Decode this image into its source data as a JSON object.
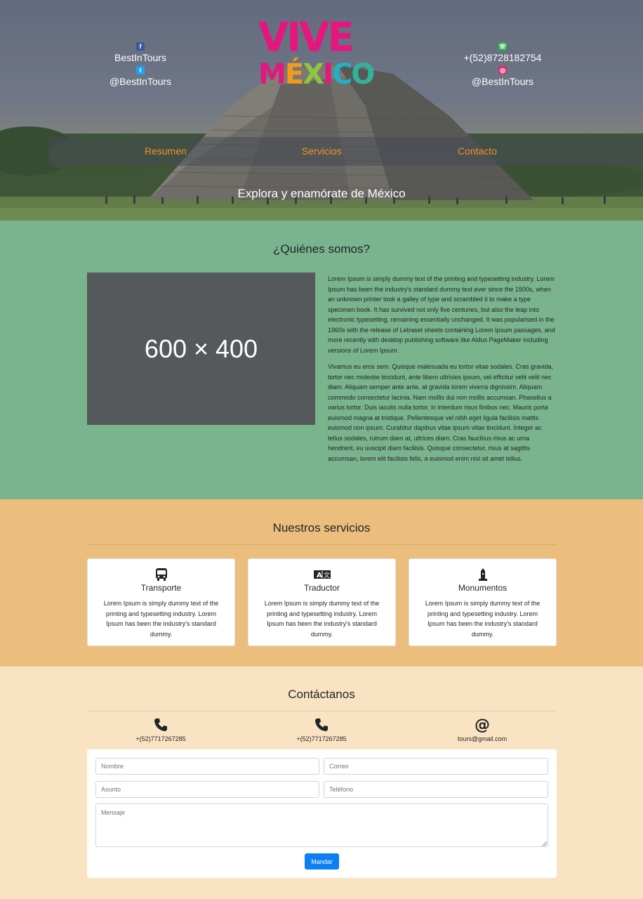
{
  "header": {
    "left_social": [
      {
        "icon": "facebook-icon",
        "label": "BestInTours"
      },
      {
        "icon": "twitter-icon",
        "label": "@BestInTours"
      }
    ],
    "right_social": [
      {
        "icon": "whatsapp-icon",
        "label": "+(52)8728182754"
      },
      {
        "icon": "instagram-icon",
        "label": "@BestInTours"
      }
    ],
    "logo": {
      "line1": "VIVE",
      "line2_letters": [
        "M",
        "É",
        "X",
        "I",
        "C",
        "O"
      ]
    },
    "nav": [
      "Resumen",
      "Servicios",
      "Contacto"
    ],
    "tagline": "Explora y enamórate de México"
  },
  "about": {
    "title": "¿Quiénes somos?",
    "image_placeholder": "600 × 400",
    "paragraphs": [
      "Lorem Ipsum is simply dummy text of the printing and typesetting industry. Lorem Ipsum has been the industry's standard dummy text ever since the 1500s, when an unknown printer took a galley of type and scrambled it to make a type specimen book. It has survived not only five centuries, but also the leap into electronic typesetting, remaining essentially unchanged. It was popularised in the 1960s with the release of Letraset sheets containing Lorem Ipsum passages, and more recently with desktop publishing software like Aldus PageMaker including versions of Lorem Ipsum.",
      "Vivamus eu eros sem. Quisque malesuada eu tortor vitae sodales. Cras gravida, tortor nec molestie tincidunt, ante libero ultricies ipsum, vel efficitur velit velit nec diam. Aliquam semper ante ante, at gravida lorem viverra dignissim. Aliquam commodo consectetur lacinia. Nam mollis dui non mollis accumsan. Phasellus a varius tortor. Duis iaculis nulla tortor, in interdum risus finibus nec. Mauris porta euismod magna at tristique. Pellentesque vel nibh eget ligula facilisis mattis euismod non ipsum. Curabitur dapibus vitae ipsum vitae tincidunt. Integer ac tellus sodales, rutrum diam at, ultrices diam. Cras faucibus risus ac urna hendrerit, eu suscipit diam facilisis. Quisque consectetur, risus at sagittis accumsan, lorem elit facilisis felis, a euismod enim nisl sit amet tellus."
    ]
  },
  "services": {
    "title": "Nuestros servicios",
    "cards": [
      {
        "icon": "bus-icon",
        "title": "Transporte",
        "desc": "Lorem Ipsum is simply dummy text of the printing and typesetting industry. Lorem Ipsum has been the industry's standard dummy."
      },
      {
        "icon": "translate-icon",
        "title": "Traductor",
        "desc": "Lorem Ipsum is simply dummy text of the printing and typesetting industry. Lorem Ipsum has been the industry's standard dummy."
      },
      {
        "icon": "monument-icon",
        "title": "Monumentos",
        "desc": "Lorem Ipsum is simply dummy text of the printing and typesetting industry. Lorem Ipsum has been the industry's standard dummy."
      }
    ]
  },
  "contact": {
    "title": "Contáctanos",
    "items": [
      {
        "icon": "phone-icon",
        "text": "+(52)7717267285"
      },
      {
        "icon": "phone-icon",
        "text": "+(52)7717267285"
      },
      {
        "icon": "at-icon",
        "text": "tours@gmail.com"
      }
    ],
    "form": {
      "name_placeholder": "Nombre",
      "email_placeholder": "Correo",
      "subject_placeholder": "Asunto",
      "phone_placeholder": "Teléfono",
      "message_placeholder": "Mensaje",
      "submit_label": "Mandar"
    }
  },
  "colors": {
    "hero_nav_link": "#f0941e",
    "about_bg": "#7ab48c",
    "services_bg": "#ecbe7d",
    "contact_bg": "#fae3c2",
    "button": "#0d7ff2",
    "logo_pink": "#e6167f"
  }
}
